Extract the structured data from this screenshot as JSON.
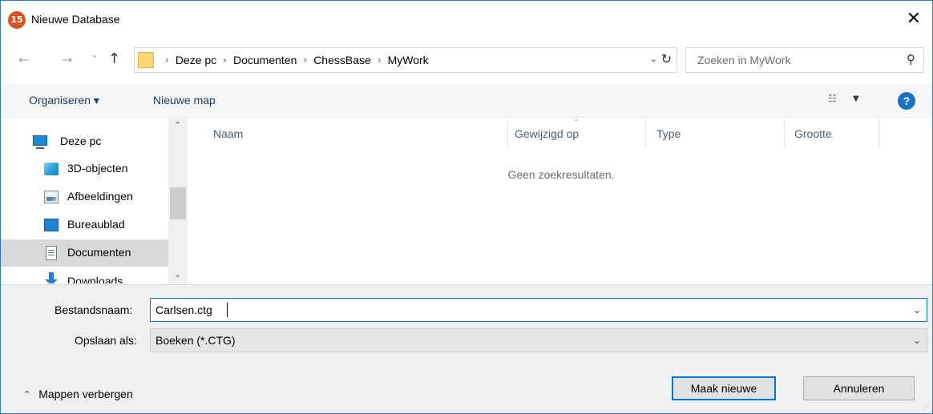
{
  "window": {
    "title": "Nieuwe Database",
    "app_icon_text": "15",
    "close_glyph": "✕"
  },
  "nav": {
    "back_glyph": "←",
    "forward_glyph": "→",
    "recent_glyph": "⌄",
    "up_glyph": "↑",
    "breadcrumb": [
      "Deze pc",
      "Documenten",
      "ChessBase",
      "MyWork"
    ],
    "separator": "›",
    "dropdown_glyph": "⌄",
    "refresh_glyph": "↻",
    "search_placeholder": "Zoeken in MyWork",
    "search_glyph": "⚲"
  },
  "toolbar": {
    "organize_label": "Organiseren ▾",
    "new_folder_label": "Nieuwe map",
    "view_glyph": "☷",
    "view_caret": "▼",
    "help_glyph": "?"
  },
  "sidebar": {
    "items": [
      {
        "label": "Deze pc",
        "icon": "computer-icon"
      },
      {
        "label": "3D-objecten",
        "icon": "cube-icon"
      },
      {
        "label": "Afbeeldingen",
        "icon": "pictures-icon"
      },
      {
        "label": "Bureaublad",
        "icon": "desktop-icon"
      },
      {
        "label": "Documenten",
        "icon": "document-icon",
        "selected": true
      },
      {
        "label": "Downloads",
        "icon": "download-icon"
      }
    ],
    "scroll_up": "⌃",
    "scroll_down": "⌄"
  },
  "content": {
    "columns": [
      "Naam",
      "Gewijzigd op",
      "Type",
      "Grootte"
    ],
    "sort_glyph": "⌄",
    "empty_text": "Geen zoekresultaten."
  },
  "form": {
    "filename_label": "Bestandsnaam:",
    "filename_value": "Carlsen.ctg",
    "filetype_label": "Opslaan als:",
    "filetype_value": "Boeken (*.CTG)",
    "dropdown_glyph": "⌄"
  },
  "footer": {
    "hide_folders_label": "Mappen verbergen",
    "hide_folders_glyph": "⌃",
    "create_button": "Maak nieuwe",
    "cancel_button": "Annuleren",
    "grip_glyph": "⋰"
  },
  "colors": {
    "accent": "#0078d7",
    "selected_bg": "#d9d9d9",
    "toolbar_bg": "#f5f6f7",
    "footer_bg": "#f0f0f0",
    "app_icon": "#d9531e"
  }
}
